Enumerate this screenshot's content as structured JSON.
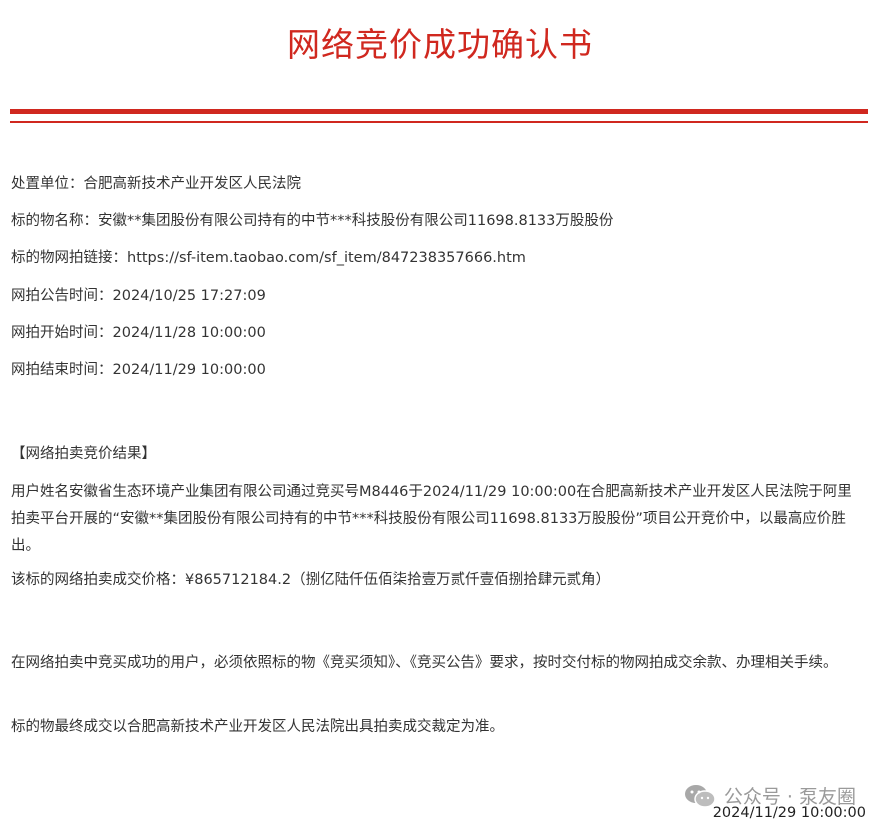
{
  "doc": {
    "title": "网络竞价成功确认书",
    "info": {
      "unit": "处置单位：合肥高新技术产业开发区人民法院",
      "item_name": "标的物名称：安徽**集团股份有限公司持有的中节***科技股份有限公司11698.8133万股股份",
      "item_link": "标的物网拍链接：https://sf-item.taobao.com/sf_item/847238357666.htm",
      "announce_time": "网拍公告时间：2024/10/25 17:27:09",
      "start_time": "网拍开始时间：2024/11/28 10:00:00",
      "end_time": "网拍结束时间：2024/11/29 10:00:00"
    },
    "result": {
      "heading": "【网络拍卖竞价结果】",
      "paragraph": "用户姓名安徽省生态环境产业集团有限公司通过竞买号M8446于2024/11/29 10:00:00在合肥高新技术产业开发区人民法院于阿里拍卖平台开展的“安徽**集团股份有限公司持有的中节***科技股份有限公司11698.8133万股股份”项目公开竞价中，以最高应价胜出。",
      "price": "该标的网络拍卖成交价格：¥865712184.2（捌亿陆仟伍佰柒拾壹万贰仟壹佰捌拾肆元贰角）"
    },
    "notice": {
      "paragraph1": "在网络拍卖中竞买成功的用户，必须依照标的物《竞买须知》、《竞买公告》要求，按时交付标的物网拍成交余款、办理相关手续。",
      "paragraph2": "标的物最终成交以合肥高新技术产业开发区人民法院出具拍卖成交裁定为准。"
    },
    "watermark": {
      "text": "公众号 · 泵友圈",
      "icon": "wechat-icon"
    },
    "footer_date": "2024/11/29 10:00:00"
  },
  "colors": {
    "accent": "#d0281f",
    "text": "#333333",
    "watermark": "#9a9a9a"
  }
}
